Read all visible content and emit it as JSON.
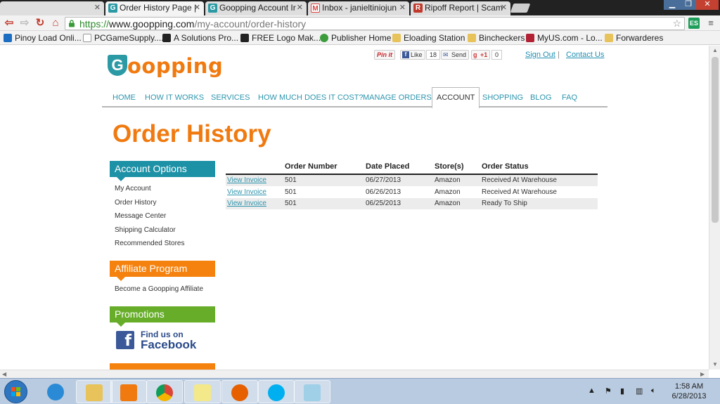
{
  "browser": {
    "tabs": [
      {
        "title": "",
        "active": false
      },
      {
        "title": "Order History Page |",
        "active": true
      },
      {
        "title": "Goopping Account Ir",
        "active": false
      },
      {
        "title": "Inbox - janieltiniojun",
        "active": false
      },
      {
        "title": "Ripoff Report | Scam",
        "active": false
      }
    ],
    "url": {
      "scheme": "https://",
      "host": "www.goopping.com",
      "path": "/my-account/order-history"
    },
    "extension_badge": "ES",
    "bookmarks": [
      "Pinoy Load Onli...",
      "PCGameSupply....",
      "A Solutions Pro...",
      "FREE Logo Mak...",
      "Publisher Home",
      "Eloading Station",
      "Bincheckers",
      "MyUS.com - Lo...",
      "Forwarderes"
    ]
  },
  "site": {
    "logo": {
      "initial": "G",
      "rest": "oopping"
    },
    "social": {
      "pinit": "Pin it",
      "like": "Like",
      "like_count": "18",
      "send": "Send",
      "gplus": "+1",
      "gplus_count": "0"
    },
    "header_links": {
      "sign_out": "Sign Out",
      "separator": "|",
      "contact_us": "Contact Us"
    },
    "nav": [
      "HOME",
      "HOW IT WORKS",
      "SERVICES",
      "HOW MUCH DOES IT COST?",
      "MANAGE ORDERS",
      "ACCOUNT",
      "SHOPPING",
      "BLOG",
      "FAQ"
    ],
    "nav_active": "ACCOUNT",
    "page_title": "Order History",
    "sidebar": {
      "account_options": {
        "heading": "Account Options",
        "links": [
          "My Account",
          "Order History",
          "Message Center",
          "Shipping Calculator",
          "Recommended Stores"
        ]
      },
      "affiliate": {
        "heading": "Affiliate Program",
        "links": [
          "Become a Goopping Affiliate"
        ]
      },
      "promotions": {
        "heading": "Promotions",
        "facebook_line1": "Find us on",
        "facebook_line2": "Facebook"
      }
    },
    "orders": {
      "columns": [
        "Order Number",
        "Date Placed",
        "Store(s)",
        "Order Status"
      ],
      "rows": [
        {
          "action": "View Invoice",
          "order_number": "501",
          "date": "06/27/2013",
          "store": "Amazon",
          "status": "Received At Warehouse"
        },
        {
          "action": "View Invoice",
          "order_number": "501",
          "date": "06/26/2013",
          "store": "Amazon",
          "status": "Received At Warehouse"
        },
        {
          "action": "View Invoice",
          "order_number": "501",
          "date": "06/25/2013",
          "store": "Amazon",
          "status": "Ready To Ship"
        }
      ]
    }
  },
  "taskbar": {
    "time": "1:58 AM",
    "date": "6/28/2013"
  },
  "colors": {
    "brand_orange": "#f07a10",
    "brand_teal": "#1d91a6",
    "link": "#2e95ad",
    "promo_green": "#67ad2a"
  }
}
